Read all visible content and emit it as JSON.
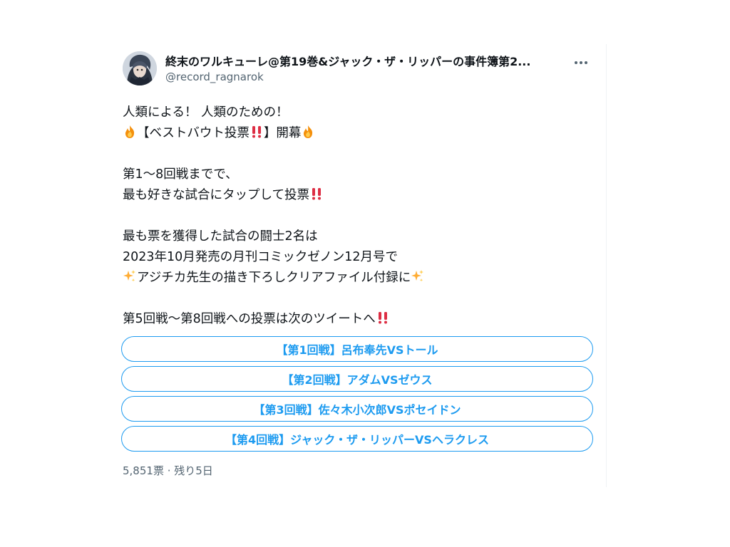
{
  "author": {
    "name": "終末のワルキューレ@第19巻&ジャック・ザ・リッパーの事件簿第2...",
    "handle": "@record_ragnarok"
  },
  "tweet": {
    "line1": "人類による！ 人類のための！",
    "line2_text": "【ベストバウト投票",
    "line2_end": "】開幕",
    "line3": "第1〜8回戦までで、",
    "line4": "最も好きな試合にタップして投票",
    "line5": "最も票を獲得した試合の闘士2名は",
    "line6": "2023年10月発売の月刊コミックゼノン12月号で",
    "line7": "アジチカ先生の描き下ろしクリアファイル付録に",
    "line8": "第5回戦〜第8回戦への投票は次のツイートへ"
  },
  "poll": {
    "options": [
      "【第1回戦】呂布奉先VSトール",
      "【第2回戦】アダムVSゼウス",
      "【第3回戦】佐々木小次郎VSポセイドン",
      "【第4回戦】ジャック・ザ・リッパーVSヘラクレス"
    ],
    "footer": "5,851票 · 残り5日"
  },
  "colors": {
    "accent": "#1d9bf0",
    "secondary_text": "#536471",
    "primary_text": "#0f1419"
  },
  "icons": [
    "more-options-icon",
    "fire-emoji-icon",
    "double-exclamation-emoji-icon",
    "sparkles-emoji-icon"
  ]
}
